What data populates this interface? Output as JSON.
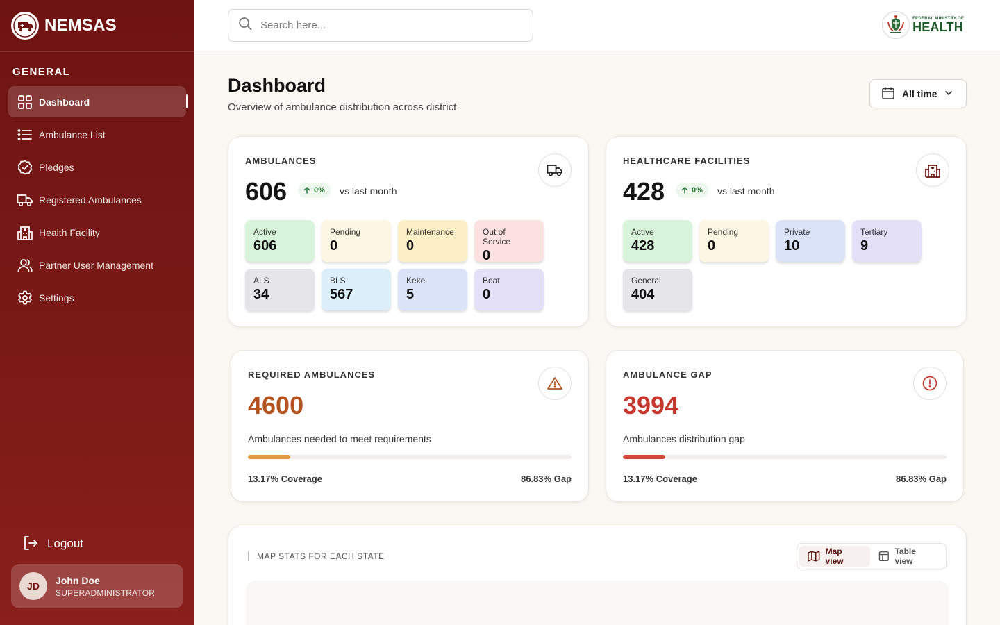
{
  "brand": {
    "name": "NEMSAS"
  },
  "sidebar": {
    "section": "GENERAL",
    "items": [
      {
        "label": "Dashboard",
        "icon": "grid-icon",
        "active": true
      },
      {
        "label": "Ambulance List",
        "icon": "list-icon"
      },
      {
        "label": "Pledges",
        "icon": "badge-check-icon"
      },
      {
        "label": "Registered Ambulances",
        "icon": "truck-icon"
      },
      {
        "label": "Health Facility",
        "icon": "building-icon"
      },
      {
        "label": "Partner User Management",
        "icon": "users-icon"
      },
      {
        "label": "Settings",
        "icon": "gear-icon"
      }
    ],
    "logout": "Logout",
    "user": {
      "initials": "JD",
      "name": "John Doe",
      "role": "SUPERADMINISTRATOR"
    }
  },
  "header": {
    "search_placeholder": "Search here...",
    "ministry_small": "FEDERAL MINISTRY OF",
    "ministry_big": "HEALTH"
  },
  "page": {
    "title": "Dashboard",
    "subtitle": "Overview of ambulance distribution across district",
    "time_filter": "All time"
  },
  "ambulances": {
    "title": "AMBULANCES",
    "total": "606",
    "trend": "0%",
    "trend_label": "vs last month",
    "tiles": [
      {
        "label": "Active",
        "value": "606"
      },
      {
        "label": "Pending",
        "value": "0"
      },
      {
        "label": "Maintenance",
        "value": "0"
      },
      {
        "label": "Out of Service",
        "value": "0"
      },
      {
        "label": "ALS",
        "value": "34"
      },
      {
        "label": "BLS",
        "value": "567"
      },
      {
        "label": "Keke",
        "value": "5"
      },
      {
        "label": "Boat",
        "value": "0"
      }
    ]
  },
  "facilities": {
    "title": "HEALTHCARE FACILITIES",
    "total": "428",
    "trend": "0%",
    "trend_label": "vs last month",
    "tiles": [
      {
        "label": "Active",
        "value": "428"
      },
      {
        "label": "Pending",
        "value": "0"
      },
      {
        "label": "Private",
        "value": "10"
      },
      {
        "label": "Tertiary",
        "value": "9"
      },
      {
        "label": "General",
        "value": "404"
      }
    ]
  },
  "required": {
    "title": "REQUIRED AMBULANCES",
    "value": "4600",
    "desc": "Ambulances needed to meet requirements",
    "coverage_fraction": 0.1317,
    "coverage": "13.17% Coverage",
    "gap": "86.83% Gap",
    "color": "#e8963a",
    "value_color": "#b5531f"
  },
  "gap": {
    "title": "AMBULANCE GAP",
    "value": "3994",
    "desc": "Ambulances distribution gap",
    "coverage_fraction": 0.1317,
    "coverage": "13.17% Coverage",
    "gap": "86.83% Gap",
    "color": "#d9473b",
    "value_color": "#c8372d"
  },
  "map": {
    "title": "MAP STATS FOR EACH STATE",
    "views": [
      {
        "label": "Map view",
        "active": true
      },
      {
        "label": "Table view",
        "active": false
      }
    ]
  },
  "colors": {
    "sidebar": "#6e1412",
    "accent_green": "#2c7a3a"
  }
}
